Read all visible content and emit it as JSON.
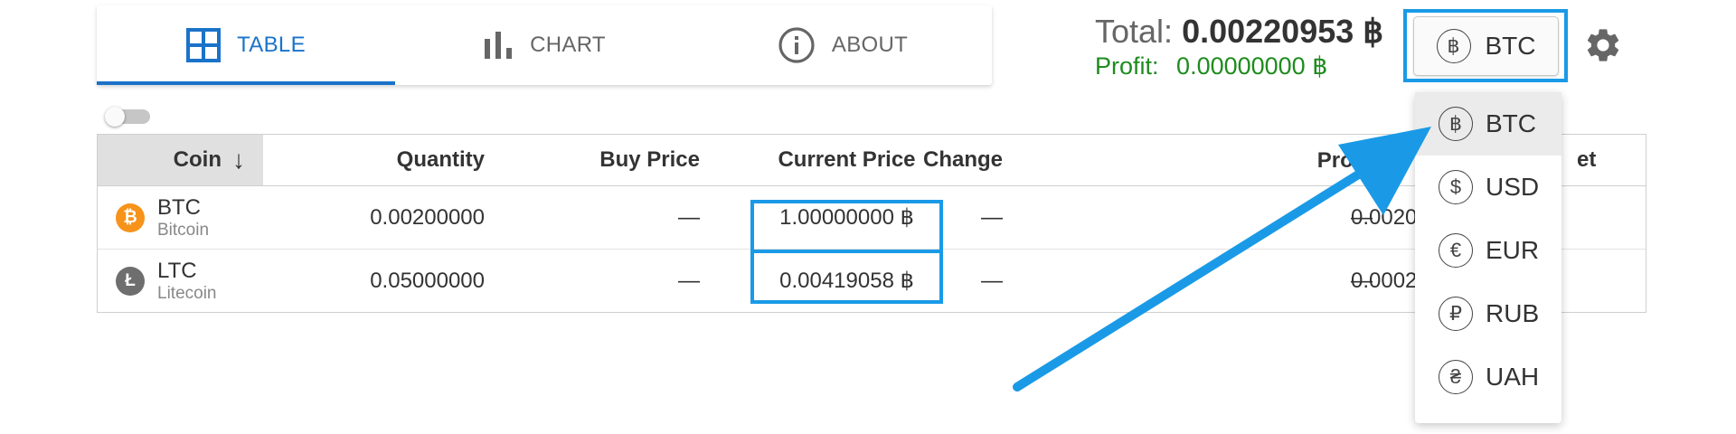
{
  "tabs": [
    {
      "label": "TABLE",
      "icon": "grid-icon",
      "active": true
    },
    {
      "label": "CHART",
      "icon": "bar-chart-icon",
      "active": false
    },
    {
      "label": "ABOUT",
      "icon": "info-icon",
      "active": false
    }
  ],
  "totals": {
    "total_label": "Total:",
    "total_value": "0.00220953 ฿",
    "profit_label": "Profit:",
    "profit_value": "0.00000000 ฿"
  },
  "currency_button": {
    "symbol": "฿",
    "label": "BTC"
  },
  "settings": {
    "icon": "gear-icon"
  },
  "table": {
    "headers": {
      "coin": "Coin",
      "sort_arrow": "↓",
      "quantity": "Quantity",
      "buy_price": "Buy Price",
      "current_price": "Current Price",
      "change": "Change",
      "profit": "Profit, ฿",
      "market": "et"
    },
    "rows": [
      {
        "symbol": "BTC",
        "name": "Bitcoin",
        "icon_glyph": "₿",
        "icon_color": "#f7931a",
        "quantity": "0.00200000",
        "buy_price": "—",
        "current_price": "1.00000000 ฿",
        "change": "—",
        "profit": "—",
        "market": "0.0020"
      },
      {
        "symbol": "LTC",
        "name": "Litecoin",
        "icon_glyph": "Ł",
        "icon_color": "#6e6e6e",
        "quantity": "0.05000000",
        "buy_price": "—",
        "current_price": "0.00419058 ฿",
        "change": "—",
        "profit": "—",
        "market": "0.0002"
      }
    ]
  },
  "dropdown": {
    "items": [
      {
        "symbol": "฿",
        "label": "BTC",
        "selected": true
      },
      {
        "symbol": "$",
        "label": "USD",
        "selected": false
      },
      {
        "symbol": "€",
        "label": "EUR",
        "selected": false
      },
      {
        "symbol": "₽",
        "label": "RUB",
        "selected": false
      },
      {
        "symbol": "₴",
        "label": "UAH",
        "selected": false
      }
    ]
  },
  "colors": {
    "accent": "#1a73c9",
    "highlight": "#1a9ae6",
    "profit": "#1e8c1e",
    "btc": "#f7931a",
    "ltc": "#6e6e6e"
  }
}
